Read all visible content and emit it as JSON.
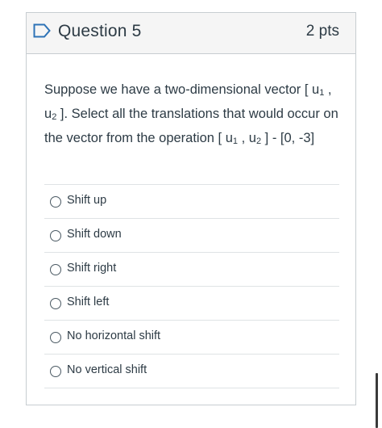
{
  "question": {
    "title": "Question 5",
    "points": "2 pts",
    "prompt": {
      "part1": "Suppose we have a two-dimensional vector [ u",
      "sub1": "1",
      "part2": " , u",
      "sub2": "2",
      "part3": " ].  Select all the translations that would occur on the vector from the operation [ u",
      "sub3": "1",
      "part4": " , u",
      "sub4": "2",
      "part5": " ] - [0, -3]"
    },
    "answers": [
      {
        "label": "Shift up"
      },
      {
        "label": "Shift down"
      },
      {
        "label": "Shift right"
      },
      {
        "label": "Shift left"
      },
      {
        "label": "No horizontal shift"
      },
      {
        "label": "No vertical shift"
      }
    ]
  },
  "icons": {
    "bookmark": "bookmark-icon"
  },
  "colors": {
    "bookmark_outline": "#2d72b6",
    "header_bg": "#f5f5f5",
    "text": "#2d3b45",
    "border": "#c7cdd1"
  }
}
